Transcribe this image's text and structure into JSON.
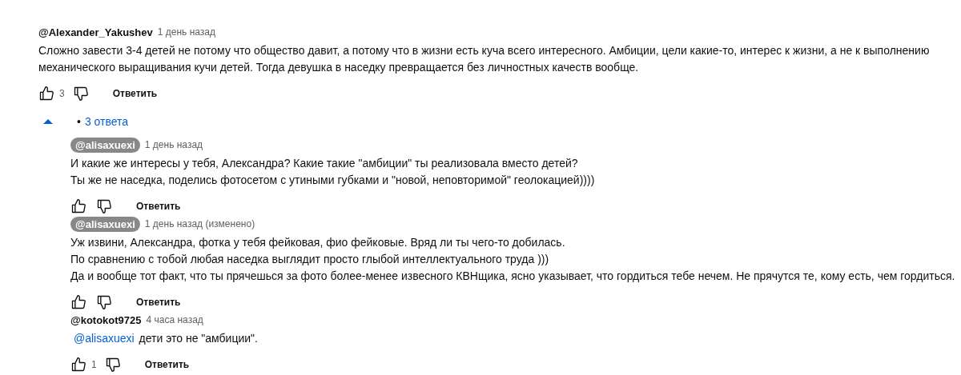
{
  "comment": {
    "author": "@Alexander_Yakushev",
    "author_highlighted": false,
    "time": "1 день назад",
    "text": [
      "Сложно завести 3-4 детей не потому что общество давит, а потому что в жизни есть куча всего интересного. Амбиции, цели какие-то, интерес к жизни, а не к выполнению",
      "механического выращивания кучи детей. Тогда девушка в наседку превращается без личностных качеств вообще."
    ],
    "likes": "3",
    "reply_label": "Ответить"
  },
  "replies_toggle": {
    "expanded": true,
    "bullet": "•",
    "label": "3 ответа"
  },
  "replies": [
    {
      "author": "@alisaxuexi",
      "author_highlighted": true,
      "time": "1 день назад",
      "text": [
        "И какие же интересы у тебя, Александра? Какие такие \"амбиции\" ты реализовала вместо детей?",
        "Ты же не наседка, поделись фотосетом с утиными губками и \"новой, неповторимой\" геолокацией))))"
      ],
      "reply_label": "Ответить"
    },
    {
      "author": "@alisaxuexi",
      "author_highlighted": true,
      "time": "1 день назад (изменено)",
      "text": [
        "Уж извини, Александра, фотка у тебя фейковая, фио фейковые. Вряд ли ты чего-то добилась.",
        "По сравнению с тобой любая наседка выглядит просто глыбой интеллектуального труда )))",
        "Да и вообще тот факт, что ты прячешься за фото более-менее извесного КВНщика, ясно указывает, что гордиться тебе нечем. Не прячутся те, кому есть, чем гордиться."
      ],
      "reply_label": "Ответить"
    },
    {
      "author": "@kotokot9725",
      "author_highlighted": false,
      "time": "4 часа назад",
      "mention": "@alisaxuexi",
      "text": [
        "дети это не \"амбиции\"."
      ],
      "likes": "1",
      "reply_label": "Ответить"
    }
  ]
}
